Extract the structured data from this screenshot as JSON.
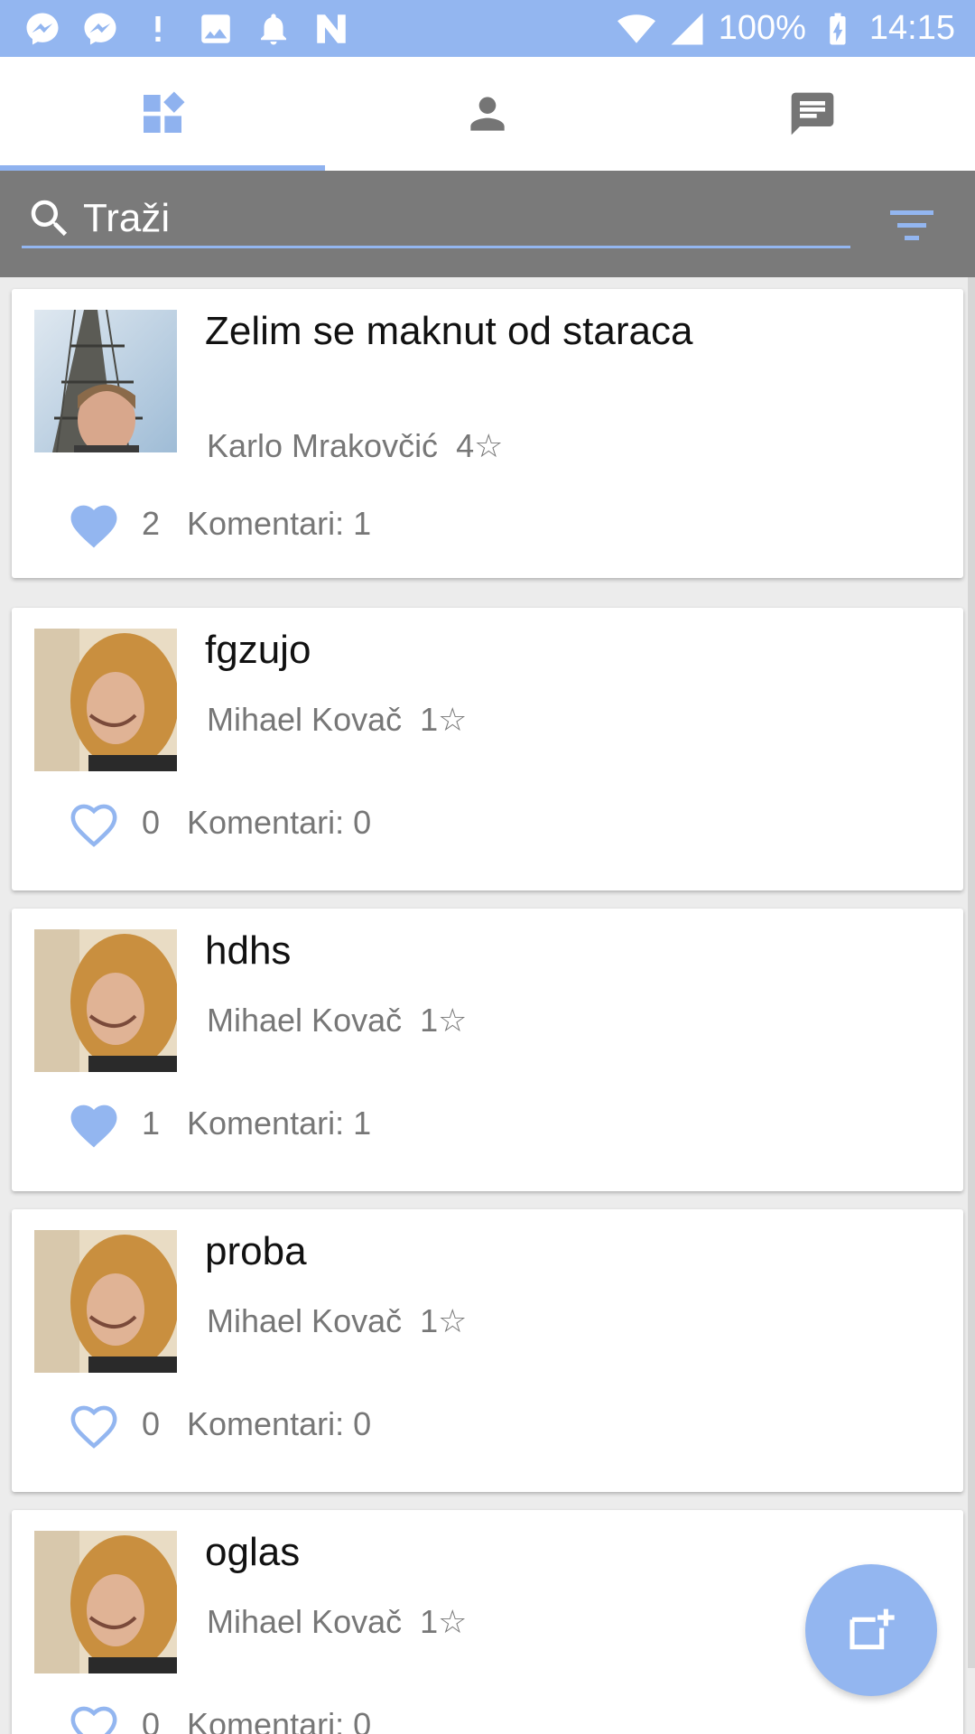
{
  "status_bar": {
    "battery": "100%",
    "time": "14:15",
    "icons": [
      "messenger-icon",
      "messenger-icon",
      "alert-icon",
      "image-icon",
      "bell-icon",
      "nfc-icon",
      "wifi-icon",
      "signal-icon",
      "battery-charging-icon"
    ]
  },
  "tabs": [
    {
      "icon": "dashboard-icon",
      "active": true
    },
    {
      "icon": "person-icon",
      "active": false
    },
    {
      "icon": "chat-icon",
      "active": false
    }
  ],
  "search": {
    "placeholder": "Traži",
    "filter_icon": "filter-icon"
  },
  "colors": {
    "accent": "#93b6f0",
    "search_bg": "#7a7a7a",
    "heart": "#93b6f0"
  },
  "posts": [
    {
      "title": "Zelim se maknut od staraca",
      "author": "Karlo Mrakovčić",
      "rating": "4☆",
      "likes": "2",
      "comments": "Komentari: 1",
      "liked": true,
      "thumb": "eiffel-selfie"
    },
    {
      "title": "fgzujo",
      "author": "Mihael Kovač",
      "rating": "1☆",
      "likes": "0",
      "comments": "Komentari: 0",
      "liked": false,
      "thumb": "curly-selfie"
    },
    {
      "title": "hdhs",
      "author": "Mihael Kovač",
      "rating": "1☆",
      "likes": "1",
      "comments": "Komentari: 1",
      "liked": true,
      "thumb": "curly-selfie"
    },
    {
      "title": "proba",
      "author": "Mihael Kovač",
      "rating": "1☆",
      "likes": "0",
      "comments": "Komentari: 0",
      "liked": false,
      "thumb": "curly-selfie"
    },
    {
      "title": "oglas",
      "author": "Mihael Kovač",
      "rating": "1☆",
      "likes": "0",
      "comments": "Komentari: 0",
      "liked": false,
      "thumb": "curly-selfie"
    }
  ],
  "fab": {
    "icon": "add-post-icon"
  }
}
